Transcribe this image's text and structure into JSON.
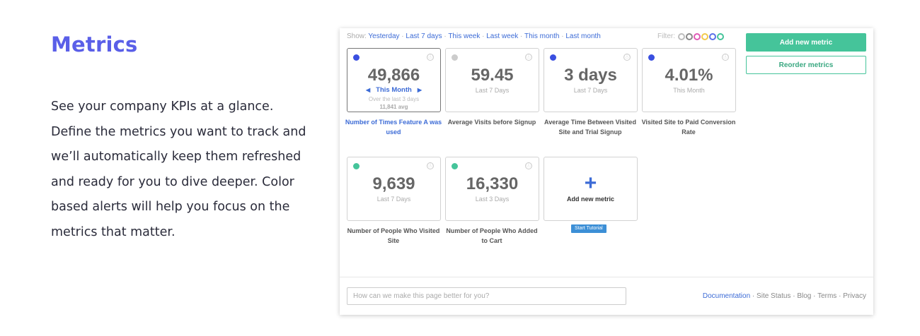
{
  "hero": {
    "title": "Metrics",
    "description": "See your company KPIs at a glance. Define the metrics you want to track and we’ll automatically keep them refreshed and ready for you to dive deeper. Color based alerts will help you focus on the metrics that matter."
  },
  "toolbar": {
    "show_label": "Show:",
    "range_links": [
      "Yesterday",
      "Last 7 days",
      "This week",
      "Last week",
      "This month",
      "Last month"
    ],
    "separator": "·",
    "filter_label": "Filter:",
    "filter_colors": [
      "#bdbdbd",
      "#888888",
      "#e05ab6",
      "#f2c94c",
      "#5a6fe8",
      "#45c49a"
    ]
  },
  "actions": {
    "add_metric_label": "Add new metric",
    "reorder_label": "Reorder metrics"
  },
  "metrics": [
    {
      "value": "49,866",
      "period": "This Month",
      "sub": "Over the last 3 days",
      "avg": "11,841 avg",
      "caption": "Number of Times Feature A was used",
      "status_color": "#3a4fe0",
      "selected": true
    },
    {
      "value": "59.45",
      "period": "Last 7 Days",
      "caption": "Average Visits before Signup",
      "status_color": "#cccccc"
    },
    {
      "value": "3 days",
      "period": "Last 7 Days",
      "caption": "Average Time Between Visited Site and Trial Signup",
      "status_color": "#3a4fe0"
    },
    {
      "value": "4.01%",
      "period": "This Month",
      "caption": "Visited Site to Paid Conversion Rate",
      "status_color": "#3a4fe0"
    },
    {
      "value": "9,639",
      "period": "Last 7 Days",
      "caption": "Number of People Who Visited Site",
      "status_color": "#45c49a"
    },
    {
      "value": "16,330",
      "period": "Last 3 Days",
      "caption": "Number of People Who Added to Cart",
      "status_color": "#45c49a"
    }
  ],
  "add_card": {
    "plus": "+",
    "label": "Add new metric",
    "tutorial_label": "Start Tutorial"
  },
  "feedback": {
    "placeholder": "How can we make this page better for you?"
  },
  "footer": {
    "documentation": "Documentation",
    "separator": "·",
    "links": [
      "Site Status",
      "Blog",
      "Terms",
      "Privacy"
    ]
  },
  "icons": {
    "info": "ⓘ",
    "prev_arrow": "◀",
    "next_arrow": "▶"
  }
}
